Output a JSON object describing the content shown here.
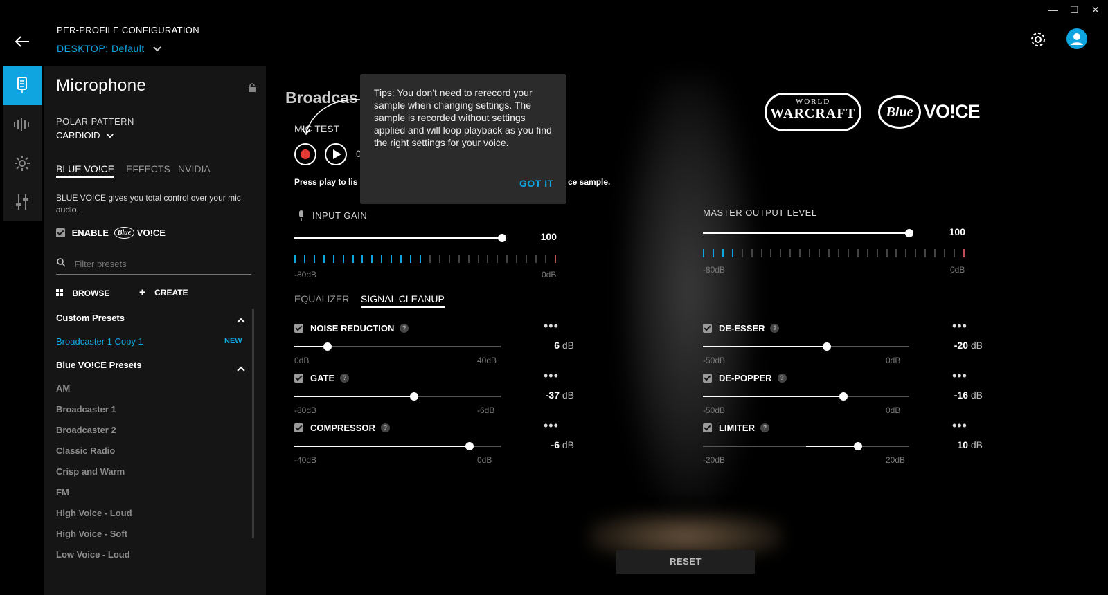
{
  "window": {
    "minimize": "—",
    "maximize": "☐",
    "close": "✕"
  },
  "header": {
    "config_title": "PER-PROFILE CONFIGURATION",
    "profile_prefix": "DESKTOP:",
    "profile_name": "Default"
  },
  "sidebar": {
    "title": "Microphone",
    "polar_pattern_label": "POLAR PATTERN",
    "polar_pattern_value": "CARDIOID",
    "tabs": [
      "BLUE VO!CE",
      "EFFECTS",
      "NVIDIA"
    ],
    "description": "BLUE VO!CE gives you total control over your mic audio.",
    "enable_label": "ENABLE",
    "enable_logo": "Blue",
    "enable_logo_suffix": "VO!CE",
    "filter_placeholder": "Filter presets",
    "browse_label": "BROWSE",
    "create_label": "CREATE",
    "custom_presets_header": "Custom Presets",
    "custom_presets": [
      {
        "name": "Broadcaster 1 Copy 1",
        "badge": "NEW"
      }
    ],
    "blue_presets_header": "Blue VO!CE Presets",
    "blue_presets": [
      "AM",
      "Broadcaster 1",
      "Broadcaster 2",
      "Classic Radio",
      "Crisp and Warm",
      "FM",
      "High Voice - Loud",
      "High Voice - Soft",
      "Low Voice - Loud"
    ]
  },
  "main": {
    "preset_title": "Broadcas",
    "mic_test_label": "MIC TEST",
    "mic_time": "0",
    "press_play_left": "Press play to lis",
    "press_play_right": "ce sample.",
    "input_gain": {
      "label": "INPUT GAIN",
      "value": "100",
      "min": "-80dB",
      "max": "0dB",
      "level": 1.0
    },
    "master_output": {
      "label": "MASTER OUTPUT LEVEL",
      "value": "100",
      "min": "-80dB",
      "max": "0dB",
      "level": 1.0
    },
    "tabs": [
      "EQUALIZER",
      "SIGNAL CLEANUP"
    ],
    "reset_label": "RESET",
    "more": "•••",
    "controls_left": [
      {
        "label": "NOISE REDUCTION",
        "value": "6",
        "unit": "dB",
        "min": "0dB",
        "max": "40dB",
        "pos": 0.16
      },
      {
        "label": "GATE",
        "value": "-37",
        "unit": "dB",
        "min": "-80dB",
        "max": "-6dB",
        "pos": 0.58
      },
      {
        "label": "COMPRESSOR",
        "value": "-6",
        "unit": "dB",
        "min": "-40dB",
        "max": "0dB",
        "pos": 0.85
      }
    ],
    "controls_right": [
      {
        "label": "DE-ESSER",
        "value": "-20",
        "unit": "dB",
        "min": "-50dB",
        "max": "0dB",
        "pos": 0.6
      },
      {
        "label": "DE-POPPER",
        "value": "-16",
        "unit": "dB",
        "min": "-50dB",
        "max": "0dB",
        "pos": 0.68
      },
      {
        "label": "LIMITER",
        "value": "10",
        "unit": "dB",
        "min": "-20dB",
        "max": "20dB",
        "pos": 0.75
      }
    ]
  },
  "logos": {
    "wow_line1": "WORLD",
    "wow_line2": "WARCRAFT",
    "blue": "Blue",
    "voice": "VO!CE"
  },
  "tooltip": {
    "text": "Tips: You don't need to rerecord your sample when changing settings. The sample is recorded without settings applied and will loop playback as you find the right settings for your voice.",
    "action": "GOT IT"
  },
  "colors": {
    "accent": "#0ea5e0",
    "record": "#e53935",
    "background": "#000000",
    "panel": "#151515"
  }
}
